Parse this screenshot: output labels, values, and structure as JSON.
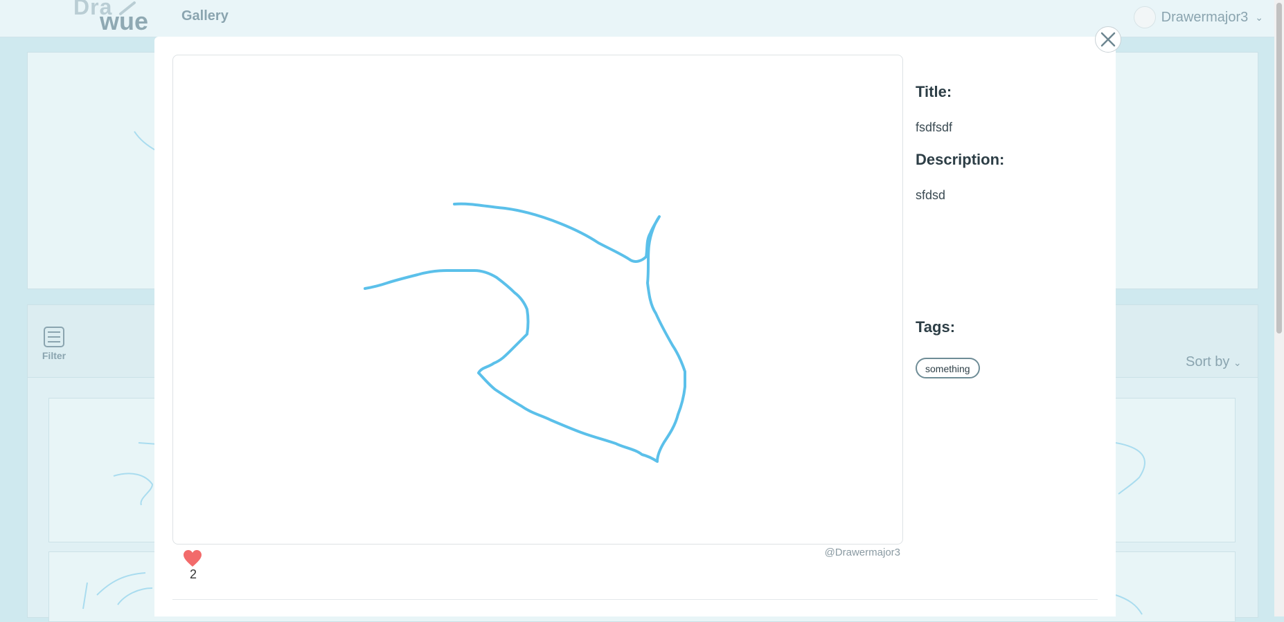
{
  "header": {
    "logo_line1": "Dra",
    "logo_line2": "wue",
    "nav_gallery": "Gallery",
    "username": "Drawermajor3"
  },
  "toolbar": {
    "filter_label": "Filter",
    "sort_label": "Sort by"
  },
  "modal": {
    "title_heading": "Title:",
    "title_value": "fsdfsdf",
    "description_heading": "Description:",
    "description_value": "sfdsd",
    "tags_heading": "Tags:",
    "tags": [
      "something"
    ],
    "likes": "2",
    "author": "@Drawermajor3",
    "stroke_color": "#5bc0ea",
    "heart_color": "#f26b6b"
  }
}
